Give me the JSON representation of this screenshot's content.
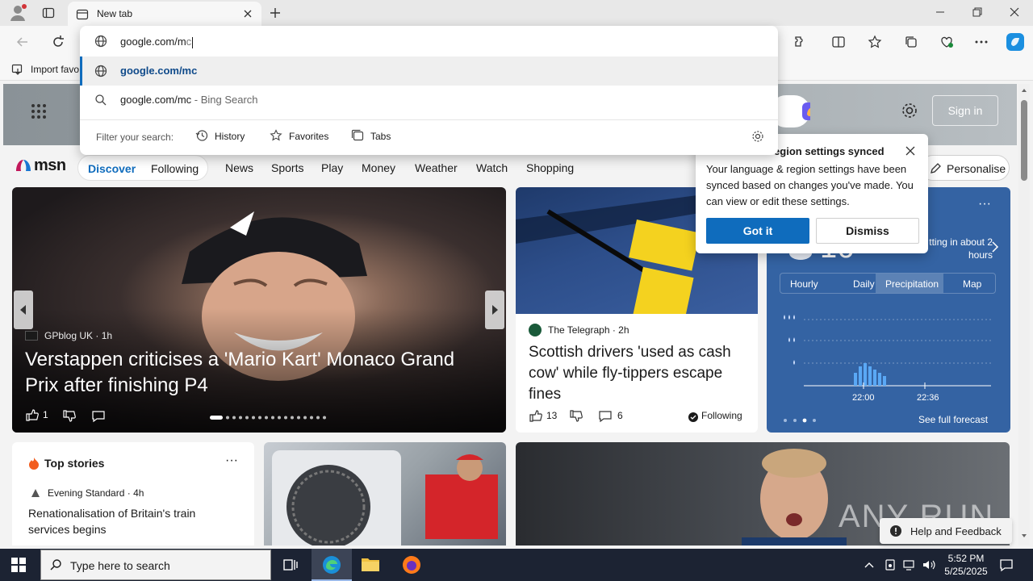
{
  "browser": {
    "tab_title": "New tab",
    "favorites_bar": {
      "import_label": "Import favo"
    },
    "omnibox": {
      "typed_text": "google.com/m",
      "autocomplete_rest": "c",
      "suggestions": [
        {
          "text": "google.com/mc",
          "sub": ""
        },
        {
          "text": "google.com/mc",
          "sub": " - Bing Search"
        }
      ],
      "filter_label": "Filter your search:",
      "filters": [
        "History",
        "Favorites",
        "Tabs"
      ]
    }
  },
  "msn": {
    "header": {
      "signin_label": "Sign in"
    },
    "logo_text": "msn",
    "segments": {
      "discover": "Discover",
      "following": "Following"
    },
    "nav": [
      "News",
      "Sports",
      "Play",
      "Money",
      "Weather",
      "Watch",
      "Shopping"
    ],
    "personalise_label": "Personalise",
    "hero": {
      "source": "GPblog UK · 1h",
      "headline": "Verstappen criticises a 'Mario Kart' Monaco Grand Prix after finishing P4",
      "likes": "1"
    },
    "card2": {
      "source": "The Telegraph · 2h",
      "headline": "Scottish drivers 'used as cash cow' while fly-tippers escape fines",
      "likes": "13",
      "comments": "6",
      "following": "Following"
    },
    "weather": {
      "temp": "16",
      "note": "tting in about 2 hours",
      "tabs": [
        "Hourly",
        "Daily",
        "Precipitation",
        "Map"
      ],
      "active_tab": "Precipitation",
      "time_labels": [
        "22:00",
        "22:36"
      ],
      "see_full": "See full forecast"
    },
    "popup": {
      "title": "region settings synced",
      "body": "Your language & region settings have been synced based on changes you've made. You can view or edit these settings.",
      "primary": "Got it",
      "secondary": "Dismiss"
    },
    "top_stories": {
      "title": "Top stories",
      "source": "Evening Standard · 4h",
      "headline": "Renationalisation of Britain's train services begins"
    },
    "watermark": "ANY RUN",
    "help_label": "Help and Feedback"
  },
  "taskbar": {
    "search_placeholder": "Type here to search",
    "time": "5:52 PM",
    "date": "5/25/2025"
  },
  "colors": {
    "accent": "#0f6cbd",
    "weather_bg": "#3463a3",
    "taskbar_bg": "#1c2333"
  }
}
